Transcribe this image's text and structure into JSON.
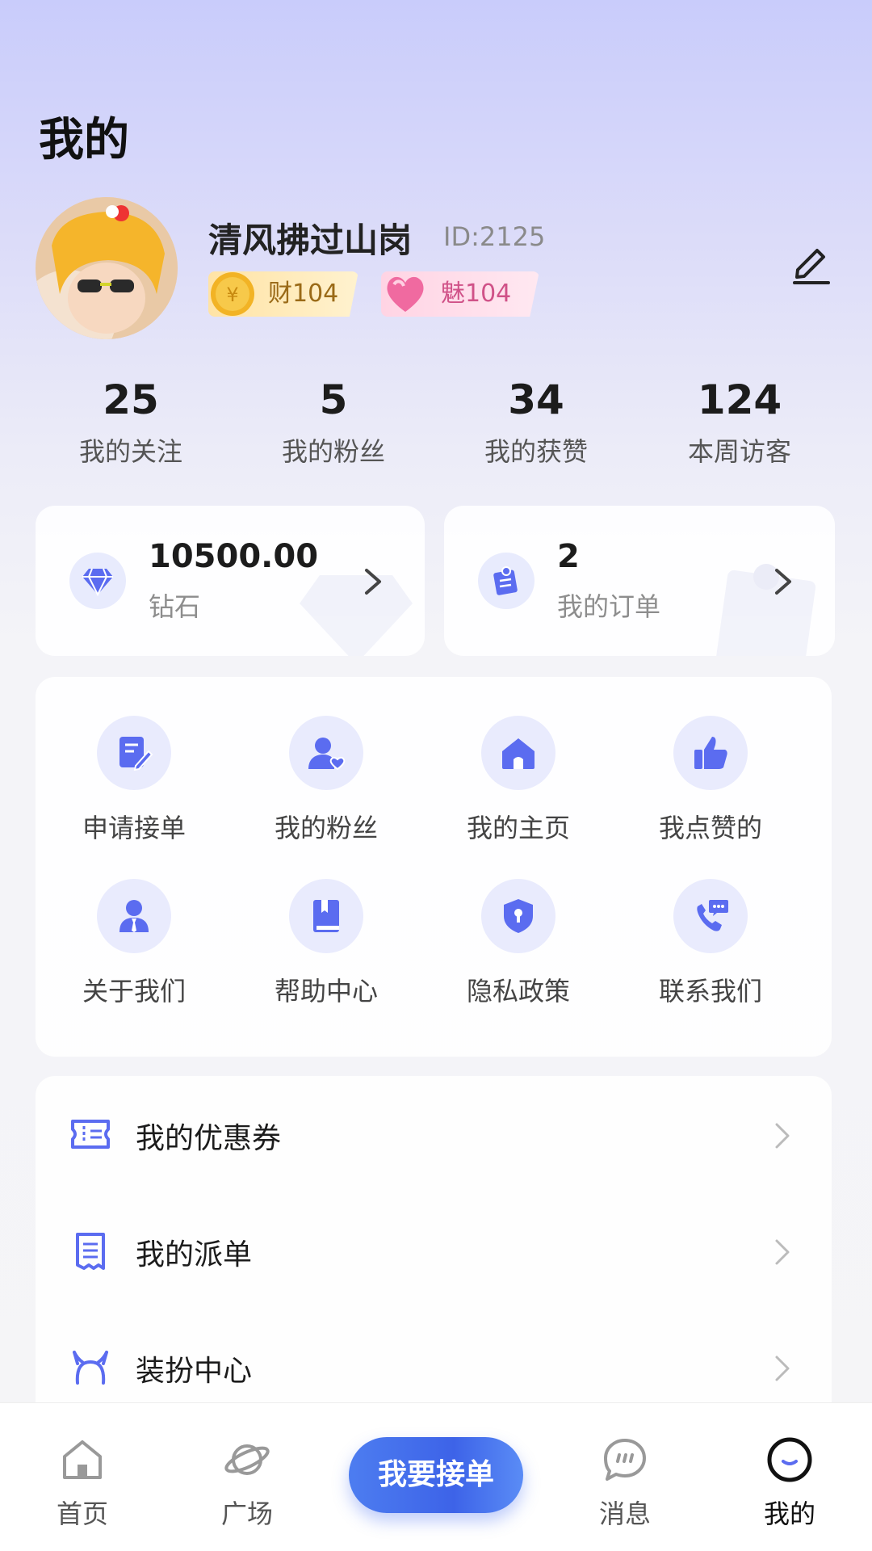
{
  "page": {
    "title": "我的"
  },
  "profile": {
    "nickname": "清风拂过山岗",
    "id_text": "ID:2125",
    "wealth_badge": "财104",
    "charm_badge": "魅104"
  },
  "stats": [
    {
      "value": "25",
      "label": "我的关注"
    },
    {
      "value": "5",
      "label": "我的粉丝"
    },
    {
      "value": "34",
      "label": "我的获赞"
    },
    {
      "value": "124",
      "label": "本周访客"
    }
  ],
  "wallet": {
    "value": "10500.00",
    "label": "钻石",
    "icon": "diamond-icon"
  },
  "orders": {
    "value": "2",
    "label": "我的订单",
    "icon": "order-icon"
  },
  "grid": [
    {
      "label": "申请接单",
      "icon": "apply-order-icon"
    },
    {
      "label": "我的粉丝",
      "icon": "fans-icon"
    },
    {
      "label": "我的主页",
      "icon": "home-page-icon"
    },
    {
      "label": "我点赞的",
      "icon": "thumbs-up-icon"
    },
    {
      "label": "关于我们",
      "icon": "about-us-icon"
    },
    {
      "label": "帮助中心",
      "icon": "help-book-icon"
    },
    {
      "label": "隐私政策",
      "icon": "privacy-shield-icon"
    },
    {
      "label": "联系我们",
      "icon": "contact-phone-icon"
    }
  ],
  "list": [
    {
      "label": "我的优惠券",
      "icon": "coupon-icon"
    },
    {
      "label": "我的派单",
      "icon": "dispatch-list-icon"
    },
    {
      "label": "装扮中心",
      "icon": "dress-up-icon"
    }
  ],
  "tabbar": {
    "home": "首页",
    "square": "广场",
    "center": "我要接单",
    "messages": "消息",
    "mine": "我的"
  },
  "colors": {
    "accent": "#5b6cf0",
    "accent_light": "#e9ebfd",
    "tab_button": "#4470ee"
  }
}
